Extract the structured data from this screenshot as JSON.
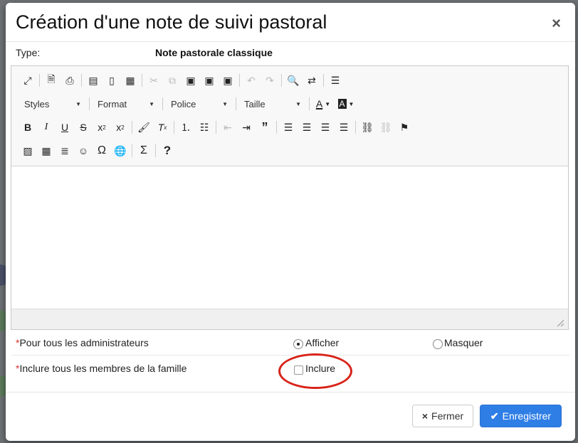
{
  "modal": {
    "title": "Création d'une note de suivi pastoral",
    "close_label": "×"
  },
  "type": {
    "label": "Type:",
    "value": "Note pastorale classique"
  },
  "editor": {
    "combos": {
      "styles": "Styles",
      "format": "Format",
      "font": "Police",
      "size": "Taille"
    }
  },
  "fields": {
    "admins": {
      "required_mark": "*",
      "label": "Pour tous les administrateurs",
      "option_show": "Afficher",
      "option_hide": "Masquer",
      "selected": "Afficher"
    },
    "family": {
      "required_mark": "*",
      "label": "Inclure tous les membres de la famille",
      "checkbox_label": "Inclure",
      "checked": false
    }
  },
  "footer": {
    "close_icon": "×",
    "close_label": "Fermer",
    "save_icon": "✔",
    "save_label": "Enregistrer"
  },
  "colors": {
    "primary": "#2f7ee6",
    "required": "#d33333",
    "annotation": "#d8241a"
  }
}
